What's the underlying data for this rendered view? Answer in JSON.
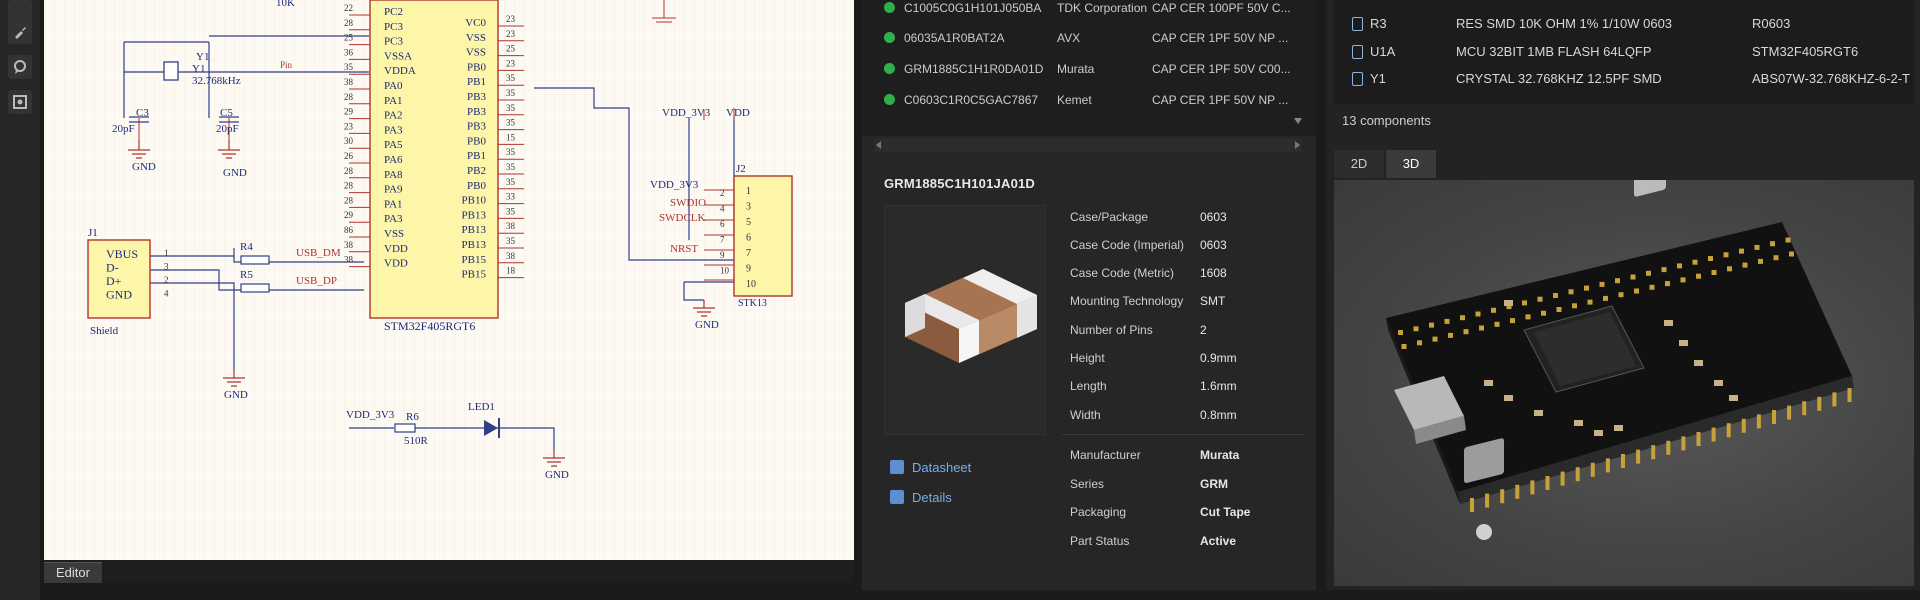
{
  "schematic": {
    "header_label": "10K",
    "crystal": {
      "ref": "Y1",
      "ref2": "Y1",
      "freq": "32.768kHz",
      "pin": "Pin"
    },
    "caps": [
      {
        "ref": "C3",
        "value": "20pF"
      },
      {
        "ref": "C5",
        "value": "20pF"
      }
    ],
    "gnd": "GND",
    "mcu": {
      "name": "STM32F405RGT6",
      "left_pins": [
        "PC2",
        "PC3",
        "PC3",
        "VSSA",
        "VDDA",
        "PA0",
        "PA1",
        "PA2",
        "PA3",
        "PA5",
        "PA6",
        "PA8",
        "PA9",
        "PA1",
        "PA3",
        "VSS",
        "VDD",
        "VDD"
      ],
      "left_nums": [
        "22",
        "28",
        "25",
        "36",
        "35",
        "38",
        "28",
        "29",
        "23",
        "30",
        "26",
        "28",
        "28",
        "28",
        "29",
        "86",
        "38",
        "38"
      ],
      "right_pins": [
        "VC0",
        "VSS",
        "VSS",
        "PB0",
        "PB1",
        "PB3",
        "PB3",
        "PB3",
        "PB0",
        "PB1",
        "PB2",
        "PB0",
        "PB10",
        "PB13",
        "PB13",
        "PB13",
        "PB15",
        "PB15"
      ],
      "right_nums": [
        "23",
        "23",
        "25",
        "23",
        "35",
        "35",
        "35",
        "35",
        "15",
        "35",
        "35",
        "35",
        "33",
        "35",
        "38",
        "35",
        "38",
        "18"
      ]
    },
    "usb": {
      "ref": "J1",
      "pins": [
        "VBUS",
        "D-",
        "D+",
        "GND"
      ],
      "pin_nums": [
        "1",
        "3",
        "2",
        "4"
      ],
      "shield": "Shield"
    },
    "resistors": [
      {
        "ref": "R4",
        "net": "USB_DM"
      },
      {
        "ref": "R5",
        "net": "USB_DP"
      }
    ],
    "swd": {
      "ref": "J2",
      "nets": [
        "VDD_3V3",
        "VDD",
        "VDD_3V3",
        "SWDIO",
        "SWDCLK",
        "NRST"
      ],
      "pin_nums": [
        "1",
        "3",
        "5",
        "6",
        "7",
        "9",
        "10"
      ],
      "pin_nums_right": [
        "2",
        "4",
        "6",
        "7",
        "9",
        "10"
      ],
      "footer": "STK13"
    },
    "led": {
      "supply": "VDD_3V3",
      "resistor": "R6",
      "value": "510R",
      "ref": "LED1"
    }
  },
  "editor_tab": "Editor",
  "parts": [
    {
      "mpn": "C1005C0G1H101J050BA",
      "mfr": "TDK Corporation",
      "desc": "CAP CER 100PF 50V C..."
    },
    {
      "mpn": "06035A1R0BAT2A",
      "mfr": "AVX",
      "desc": "CAP CER 1PF 50V NP ..."
    },
    {
      "mpn": "GRM1885C1H1R0DA01D",
      "mfr": "Murata",
      "desc": "CAP CER 1PF 50V C00..."
    },
    {
      "mpn": "C0603C1R0C5GAC7867",
      "mfr": "Kemet",
      "desc": "CAP CER 1PF 50V NP ..."
    }
  ],
  "detail": {
    "title": "GRM1885C1H101JA01D",
    "specs": [
      {
        "label": "Case/Package",
        "value": "0603"
      },
      {
        "label": "Case Code (Imperial)",
        "value": "0603"
      },
      {
        "label": "Case Code (Metric)",
        "value": "1608"
      },
      {
        "label": "Mounting Technology",
        "value": "SMT"
      },
      {
        "label": "Number of Pins",
        "value": "2"
      },
      {
        "label": "Height",
        "value": "0.9mm"
      },
      {
        "label": "Length",
        "value": "1.6mm"
      },
      {
        "label": "Width",
        "value": "0.8mm"
      }
    ],
    "maker": [
      {
        "label": "Manufacturer",
        "value": "Murata"
      },
      {
        "label": "Series",
        "value": "GRM"
      },
      {
        "label": "Packaging",
        "value": "Cut Tape"
      },
      {
        "label": "Part Status",
        "value": "Active"
      }
    ],
    "links": {
      "datasheet": "Datasheet",
      "details": "Details"
    }
  },
  "components": [
    {
      "ref": "R3",
      "desc": "RES SMD 10K OHM 1% 1/10W 0603",
      "mpn": "R0603"
    },
    {
      "ref": "U1A",
      "desc": "MCU 32BIT 1MB FLASH 64LQFP",
      "mpn": "STM32F405RGT6"
    },
    {
      "ref": "Y1",
      "desc": "CRYSTAL 32.768KHZ 12.5PF SMD",
      "mpn": "ABS07W-32.768KHZ-6-2-T"
    }
  ],
  "component_count": "13 components",
  "view_tabs": [
    "2D",
    "3D"
  ],
  "colors": {
    "accent_link": "#78aee6",
    "status_dot": "#2fb04a",
    "schematic_wire": "#2f3f8a",
    "schematic_red": "#b0332f",
    "mcu_fill": "#fdf6a8"
  }
}
